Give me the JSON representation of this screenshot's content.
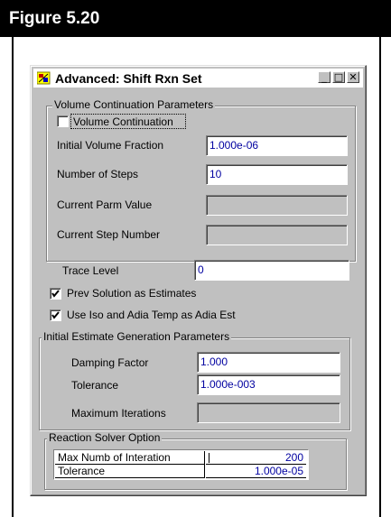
{
  "figure": {
    "title": "Figure 5.20"
  },
  "window": {
    "title": "Advanced: Shift Rxn Set",
    "controls": {
      "minimize": "_",
      "maximize": "□",
      "close": "✕"
    },
    "icon": "app-icon"
  },
  "volume_group": {
    "label": "Volume Continuation Parameters",
    "checkbox": {
      "label": "Volume Continuation",
      "checked": false
    },
    "fields": [
      {
        "label": "Initial Volume Fraction",
        "value": "1.000e-06"
      },
      {
        "label": "Number of Steps",
        "value": "10"
      },
      {
        "label": "Current Parm Value",
        "value": ""
      },
      {
        "label": "Current Step Number",
        "value": ""
      }
    ]
  },
  "trace": {
    "label": "Trace Level",
    "value": "0"
  },
  "options": [
    {
      "label": "Prev Solution as Estimates",
      "checked": true
    },
    {
      "label": "Use Iso and Adia Temp as Adia Est",
      "checked": true
    }
  ],
  "estimate_group": {
    "label": "Initial Estimate Generation Parameters",
    "fields": [
      {
        "label": "Damping Factor",
        "value": "1.000"
      },
      {
        "label": "Tolerance",
        "value": "1.000e-003"
      },
      {
        "label": "Maximum Iterations",
        "value": ""
      }
    ]
  },
  "solver_group": {
    "label": "Reaction Solver Option",
    "rows": [
      {
        "name": "Max Numb of Interation",
        "value": "200"
      },
      {
        "name": "Tolerance",
        "value": "1.000e-05"
      }
    ]
  }
}
